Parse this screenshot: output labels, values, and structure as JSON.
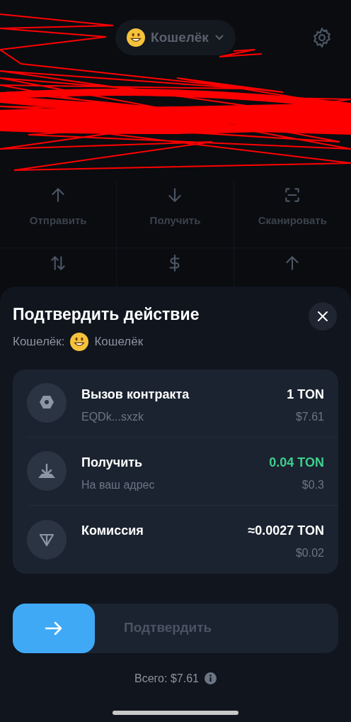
{
  "header": {
    "wallet": "Кошелёк"
  },
  "actions": [
    {
      "kind": "send",
      "label": "Отправить"
    },
    {
      "kind": "receive",
      "label": "Получить"
    },
    {
      "kind": "scan",
      "label": "Сканировать"
    },
    {
      "kind": "swap"
    },
    {
      "kind": "dollar"
    },
    {
      "kind": "up"
    }
  ],
  "sheet": {
    "title": "Подтвердить действие",
    "wallet_label": "Кошелёк:",
    "wallet_name": "Кошелёк",
    "items": [
      {
        "kind": "contract",
        "title": "Вызов контракта",
        "subtitle": "EQDk...sxzk",
        "amount": "1 TON",
        "fiat": "$7.61",
        "incoming": false
      },
      {
        "kind": "receive",
        "title": "Получить",
        "subtitle": "На ваш адрес",
        "amount": "0.04 TON",
        "fiat": "$0.3",
        "incoming": true
      },
      {
        "kind": "fee",
        "title": "Комиссия",
        "amount": "≈0.0027 TON",
        "fiat": "$0.02",
        "incoming": false
      }
    ],
    "confirm": {
      "label": "Подтвердить",
      "level": 0
    },
    "total": "Всего: $7.61"
  }
}
